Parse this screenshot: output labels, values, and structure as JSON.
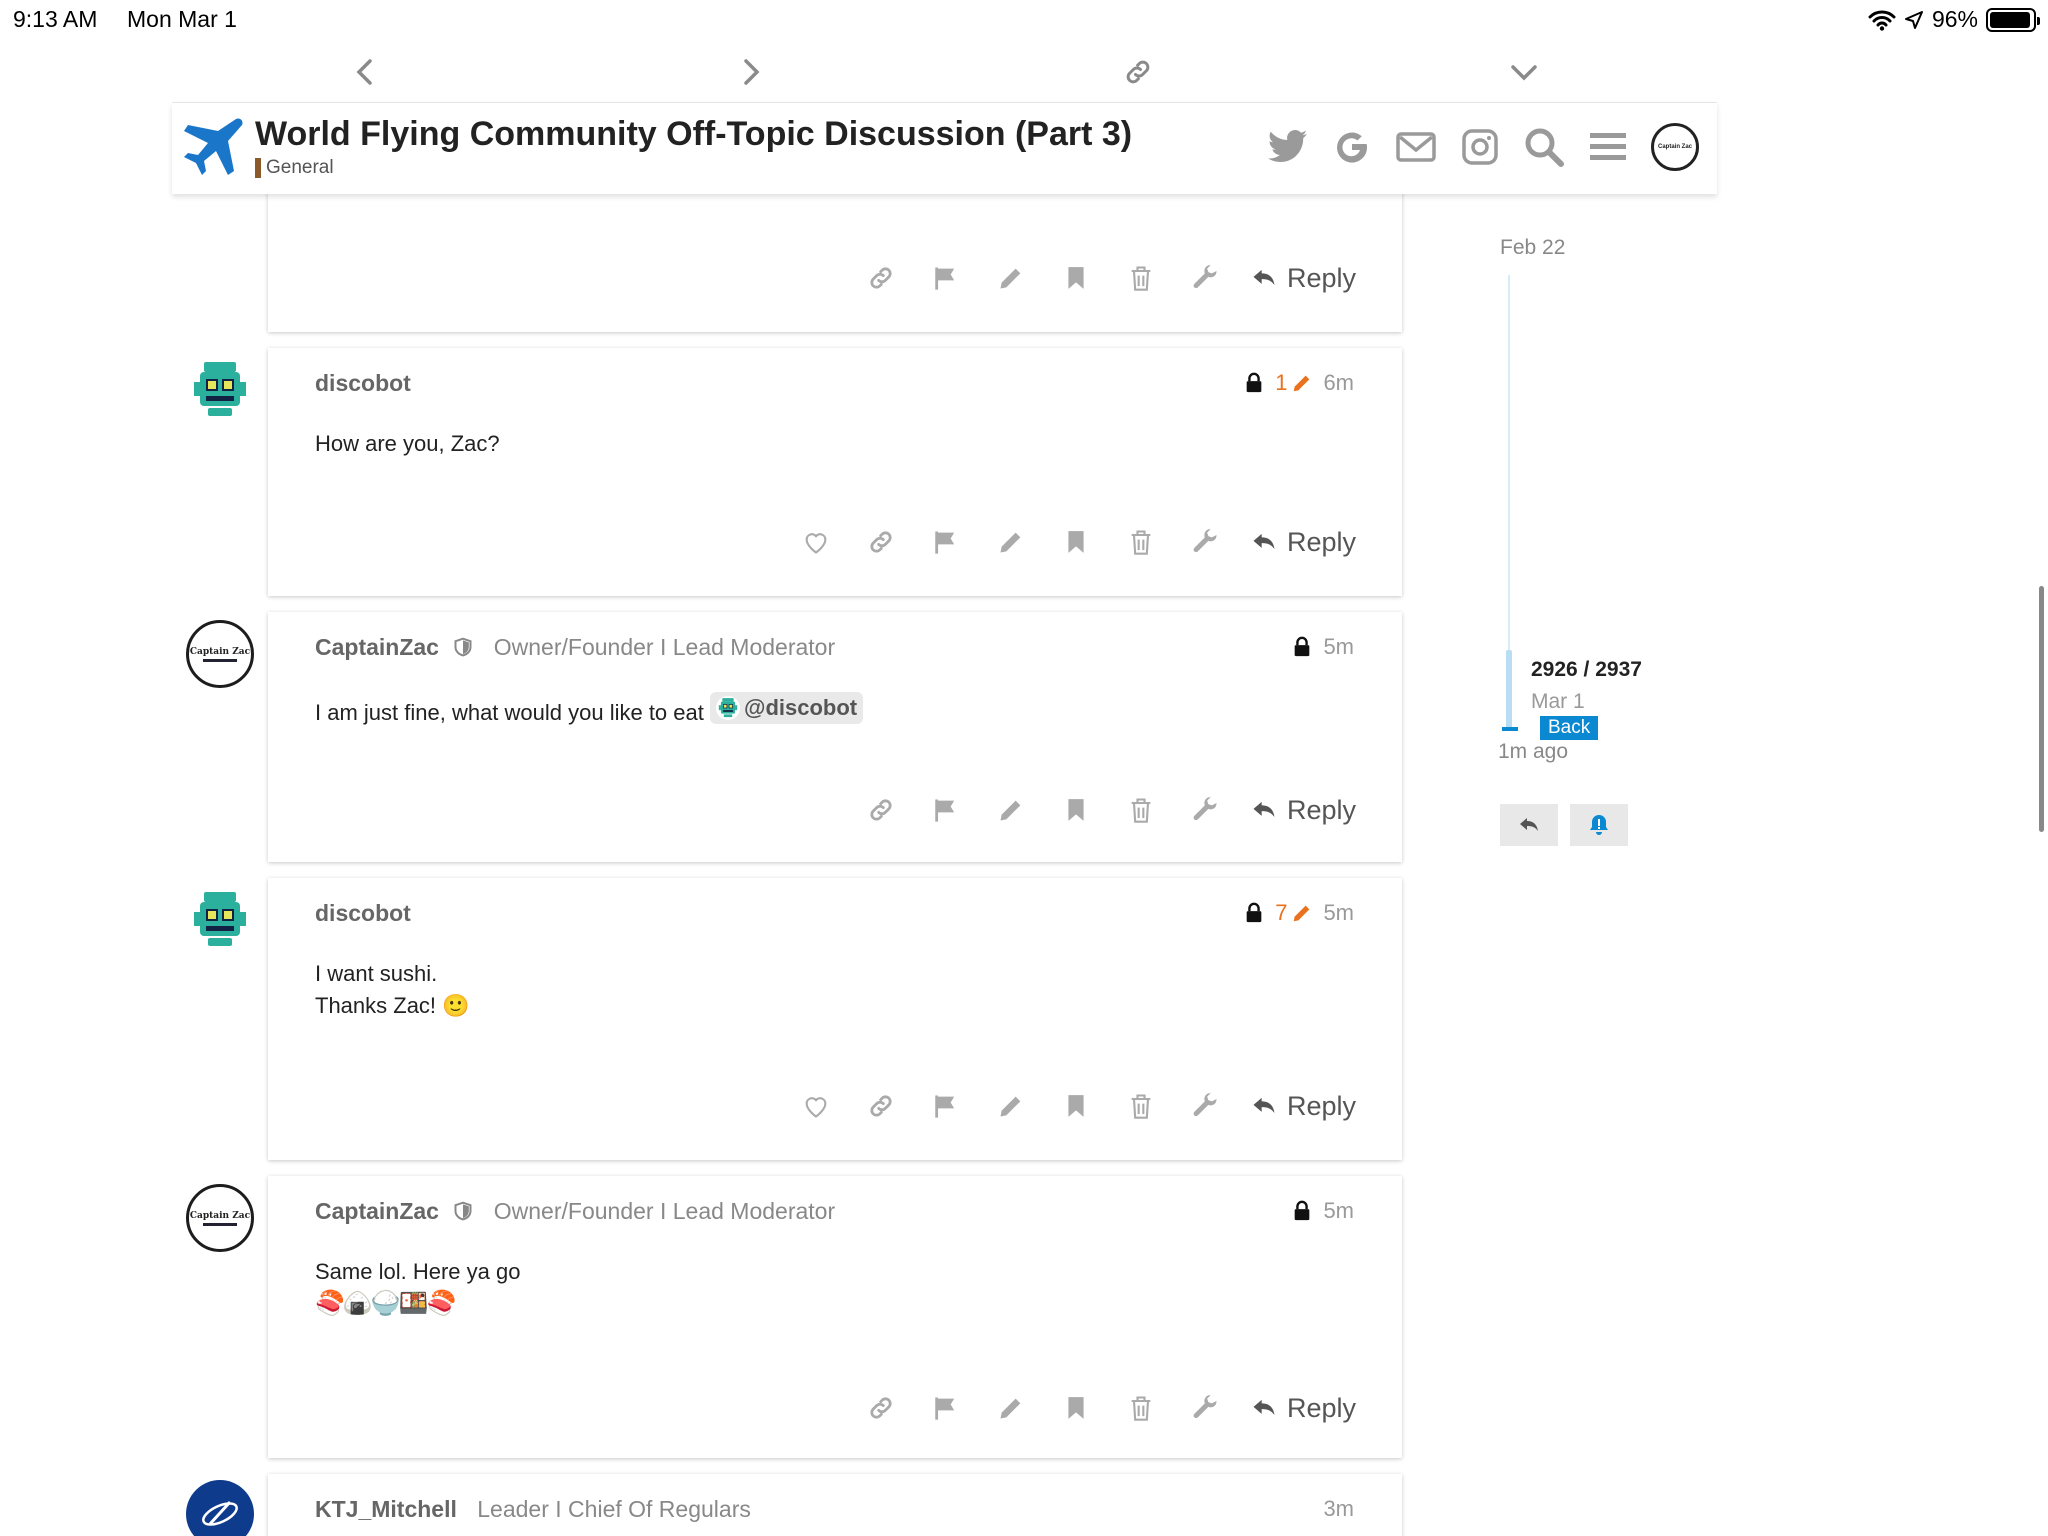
{
  "status_bar": {
    "time": "9:13 AM",
    "date": "Mon Mar 1",
    "battery": "96%",
    "battery_level": 0.96
  },
  "site": {
    "topic_title": "World Flying Community Off-Topic Discussion (Part 3)",
    "category": "General",
    "avatar_text": "Captain Zac"
  },
  "posts": [
    {
      "reply": "Reply"
    },
    {
      "username": "discobot",
      "edit_count": "1",
      "age": "6m",
      "body": "How are you, Zac?",
      "reply": "Reply"
    },
    {
      "username": "CaptainZac",
      "title": "Owner/Founder I Lead Moderator",
      "age": "5m",
      "body": "I am just fine, what would you like to eat",
      "mention": "@discobot",
      "reply": "Reply",
      "avatar_text": "Captain Zac"
    },
    {
      "username": "discobot",
      "edit_count": "7",
      "age": "5m",
      "body_line1": "I want sushi.",
      "body_line2": "Thanks Zac!",
      "emoji": "🙂",
      "reply": "Reply"
    },
    {
      "username": "CaptainZac",
      "title": "Owner/Founder I Lead Moderator",
      "age": "5m",
      "body": "Same lol. Here ya go",
      "emojis": "🍣🍙🍚🍱🍣",
      "reply": "Reply",
      "avatar_text": "Captain Zac"
    },
    {
      "username": "KTJ_Mitchell",
      "title": "Leader I Chief Of Regulars",
      "age": "3m"
    }
  ],
  "timeline": {
    "start_date": "Feb 22",
    "position": "2926 / 2937",
    "current_date": "Mar 1",
    "back": "Back",
    "last_activity": "1m ago"
  },
  "icons": {
    "nav": [
      "chevron-left-icon",
      "chevron-right-icon",
      "link-icon",
      "chevron-down-icon"
    ],
    "header": [
      "twitter-icon",
      "google-icon",
      "mail-icon",
      "instagram-icon",
      "search-icon",
      "menu-icon"
    ],
    "post_actions": [
      "heart-icon",
      "link-icon",
      "flag-icon",
      "pencil-icon",
      "bookmark-icon",
      "trash-icon",
      "wrench-icon",
      "reply-icon"
    ]
  },
  "colors": {
    "accent": "#0a88d1",
    "edit": "#e8721d",
    "discobot": "#2ab09c",
    "category": "#8b5a2b"
  }
}
